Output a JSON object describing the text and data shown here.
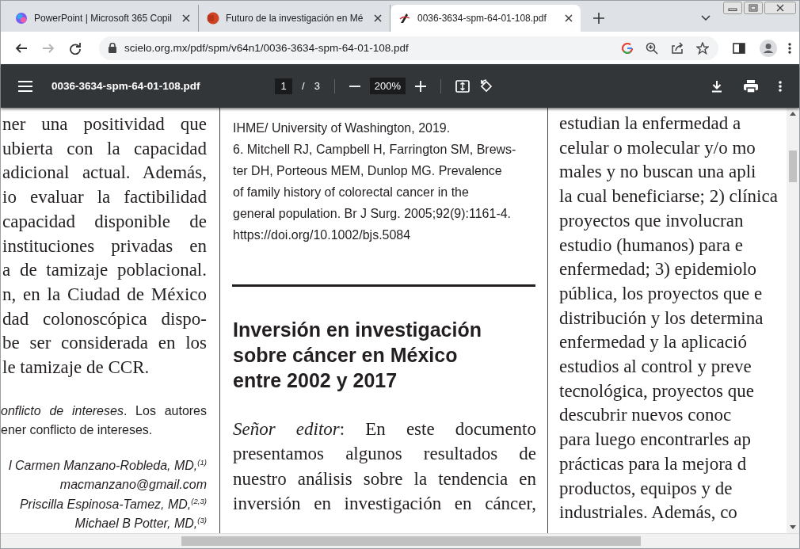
{
  "tabs": [
    {
      "title": "PowerPoint | Microsoft 365 Copil",
      "selected": false
    },
    {
      "title": "Futuro de la investigación en Mé",
      "selected": false
    },
    {
      "title": "0036-3634-spm-64-01-108.pdf",
      "selected": true
    }
  ],
  "nav_buttons": [
    {
      "kind": "back",
      "disabled": false
    },
    {
      "kind": "forward",
      "disabled": true
    },
    {
      "kind": "reload",
      "disabled": false
    }
  ],
  "address_bar": {
    "url": "scielo.org.mx/pdf/spm/v64n1/0036-3634-spm-64-01-108.pdf"
  },
  "pdf_toolbar": {
    "filename": "0036-3634-spm-64-01-108.pdf",
    "page": "1",
    "page_separator": "/",
    "page_count": "3",
    "zoom": "200%"
  },
  "left_column": {
    "body_lines": [
      "ner una positividad que",
      "ubierta con la capacidad",
      "adicional actual. Además,",
      "io evaluar la factibilidad",
      "capacidad disponible de",
      "instituciones privadas en",
      "a de tamizaje poblacional.",
      "n, en la Ciudad de México",
      "dad colonoscópica dispo-",
      "be ser considerada en los",
      "le tamizaje de CCR."
    ],
    "conflict_lines": [
      "*onflicto de intereses*. Los autores",
      "ener conflicto de intereses."
    ],
    "author_lines": [
      "l Carmen Manzano-Robleda, MD,$^{(1)}$",
      "macmanzano@gmail.com",
      "Priscilla Espinosa-Tamez, MD,$^{(2,3)}$",
      "Michael B Potter, MD,$^{(3)}$"
    ]
  },
  "middle_column": {
    "reference_lines": [
      "IHME/ University of Washington, 2019.",
      "6. Mitchell RJ, Campbell H, Farrington SM, Brews-",
      "ter DH, Porteous MEM, Dunlop MG. Prevalence",
      "of family history of colorectal cancer in the",
      "general population. Br J Surg. 2005;92(9):1161-4.",
      "https://doi.org/10.1002/bjs.5084"
    ],
    "heading_lines": [
      "Inversión en investigación",
      "sobre cáncer en México",
      "entre 2002 y 2017"
    ],
    "body_lines": [
      "*Señor editor*: En este documento",
      "presentamos algunos resultados de",
      "nuestro análisis sobre la tendencia en",
      "inversión en investigación en cáncer,"
    ]
  },
  "right_column": {
    "body_lines": [
      "estudian la enfermedad a",
      "celular o molecular y/o mo",
      "males y no buscan una apli",
      "la cual beneficiarse; 2) clínica",
      "proyectos que involucran",
      "estudio (humanos) para e",
      "enfermedad; 3) epidemiolo",
      "pública, los proyectos que e",
      "distribución y los determina",
      "enfermedad y la aplicació",
      "estudios al control y preve",
      "tecnológica, proyectos que",
      "descubrir nuevos conoc",
      "para luego encontrarles ap",
      "prácticas para la mejora d",
      "productos, equipos y de",
      "industriales. Además, co"
    ]
  }
}
